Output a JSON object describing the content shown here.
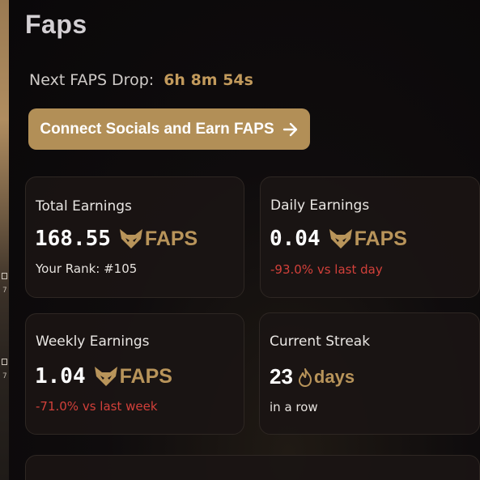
{
  "page": {
    "title": "Faps"
  },
  "drop": {
    "label": "Next FAPS Drop:",
    "time": "6h 8m 54s"
  },
  "connect_button": {
    "label": "Connect Socials and Earn FAPS"
  },
  "cards": {
    "total": {
      "label": "Total Earnings",
      "value": "168.55",
      "unit": "FAPS",
      "sub": "Your Rank: #105"
    },
    "daily": {
      "label": "Daily Earnings",
      "value": "0.04",
      "unit": "FAPS",
      "sub": "-93.0% vs last day"
    },
    "weekly": {
      "label": "Weekly Earnings",
      "value": "1.04",
      "unit": "FAPS",
      "sub": "-71.0% vs last week"
    },
    "streak": {
      "label": "Current Streak",
      "value": "23",
      "unit": "days",
      "sub": "in a row"
    }
  },
  "icons": {
    "token_icon": "fox-icon",
    "streak_icon": "flame-icon",
    "button_icon": "arrow-right-icon"
  },
  "colors": {
    "accent": "#b28f57",
    "token_gold": "#b8945a",
    "negative": "#d2403a",
    "background": "#0b090b",
    "card": "#1a1514"
  }
}
